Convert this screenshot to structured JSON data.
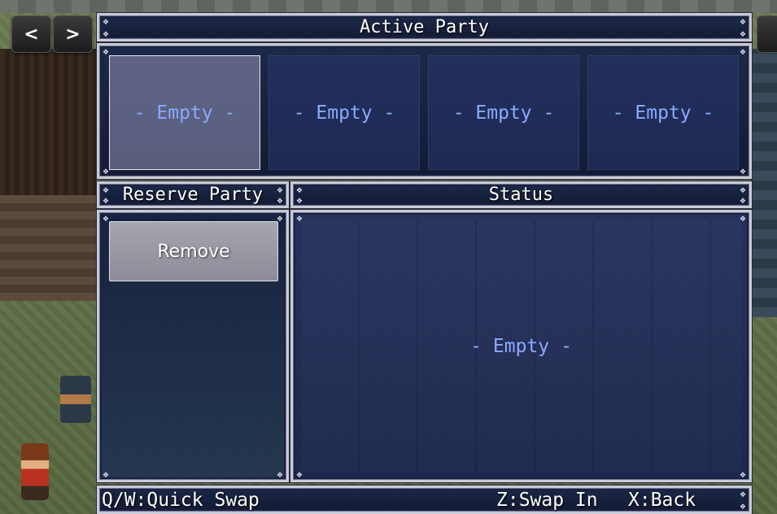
{
  "nav": {
    "prev_label": "<",
    "next_label": ">"
  },
  "active_party": {
    "title": "Active Party",
    "slots": [
      "- Empty -",
      "- Empty -",
      "- Empty -",
      "- Empty -"
    ],
    "selected_index": 0
  },
  "reserve_party": {
    "title": "Reserve Party",
    "remove_label": "Remove"
  },
  "status": {
    "title": "Status",
    "content": "- Empty -"
  },
  "help": {
    "quick_swap": "Q/W:Quick Swap",
    "swap_in": "Z:Swap In",
    "back": "X:Back"
  },
  "colors": {
    "window_bg": "#16224a",
    "empty_text": "#88aaff",
    "selected_slot": "#9696b9",
    "border": "#c9ccd6"
  }
}
